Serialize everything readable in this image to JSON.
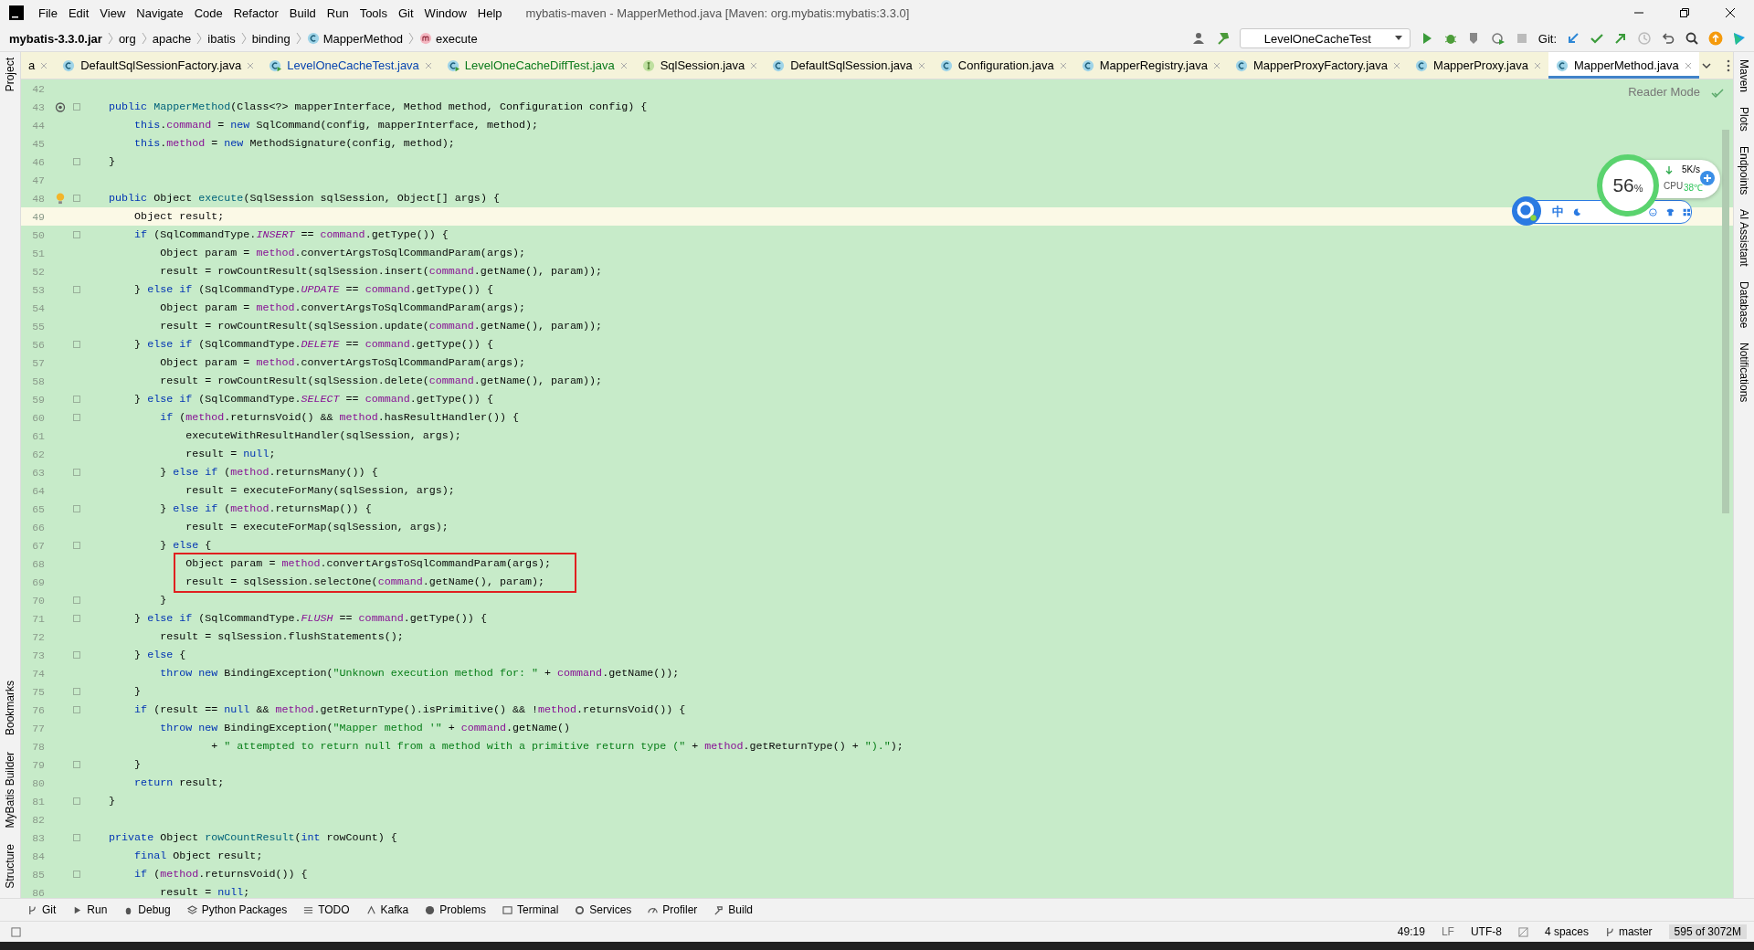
{
  "window": {
    "title": "mybatis-maven - MapperMethod.java [Maven: org.mybatis:mybatis:3.3.0]"
  },
  "menu": [
    "File",
    "Edit",
    "View",
    "Navigate",
    "Code",
    "Refactor",
    "Build",
    "Run",
    "Tools",
    "Git",
    "Window",
    "Help"
  ],
  "breadcrumbs": [
    {
      "label": "mybatis-3.3.0.jar",
      "kind": "jar"
    },
    {
      "label": "org",
      "kind": "package"
    },
    {
      "label": "apache",
      "kind": "package"
    },
    {
      "label": "ibatis",
      "kind": "package"
    },
    {
      "label": "binding",
      "kind": "package"
    },
    {
      "label": "MapperMethod",
      "kind": "class"
    },
    {
      "label": "execute",
      "kind": "method"
    }
  ],
  "toolbar": {
    "run_config": "LevelOneCacheTest",
    "git_label": "Git:"
  },
  "tabs": [
    {
      "label": "a",
      "kind": "none",
      "color": "#000000",
      "selected": false
    },
    {
      "label": "DefaultSqlSessionFactory.java",
      "kind": "class",
      "color": "#000000",
      "selected": false
    },
    {
      "label": "LevelOneCacheTest.java",
      "kind": "test",
      "color": "#0a46b0",
      "selected": false
    },
    {
      "label": "LevelOneCacheDiffTest.java",
      "kind": "test",
      "color": "#0a7a1b",
      "selected": false
    },
    {
      "label": "SqlSession.java",
      "kind": "interface",
      "color": "#000000",
      "selected": false
    },
    {
      "label": "DefaultSqlSession.java",
      "kind": "class",
      "color": "#000000",
      "selected": false
    },
    {
      "label": "Configuration.java",
      "kind": "class",
      "color": "#000000",
      "selected": false
    },
    {
      "label": "MapperRegistry.java",
      "kind": "class",
      "color": "#000000",
      "selected": false
    },
    {
      "label": "MapperProxyFactory.java",
      "kind": "class",
      "color": "#000000",
      "selected": false
    },
    {
      "label": "MapperProxy.java",
      "kind": "class",
      "color": "#000000",
      "selected": false
    },
    {
      "label": "MapperMethod.java",
      "kind": "class",
      "color": "#000000",
      "selected": true
    }
  ],
  "left_tools_top": [
    "Project"
  ],
  "left_tools_bottom": [
    "Bookmarks",
    "MyBatis Builder",
    "Structure"
  ],
  "right_tools": [
    "Maven",
    "Plots",
    "Endpoints",
    "AI Assistant",
    "Database",
    "Notifications"
  ],
  "editor": {
    "reader_mode": "Reader Mode",
    "lines": [
      {
        "num": "42",
        "fold": false
      },
      {
        "num": "43",
        "kind": "override",
        "fold": true,
        "tokens": [
          {
            "text": "    public ",
            "kind": "keyword"
          },
          {
            "text": "MapperMethod",
            "kind": "declaration"
          },
          {
            "text": "(Class<?> mapperInterface, Method method, Configuration config) {"
          }
        ]
      },
      {
        "num": "44",
        "fold": false,
        "tokens": [
          {
            "text": "        this",
            "kind": "keyword"
          },
          {
            "text": "."
          },
          {
            "text": "command",
            "kind": "field"
          },
          {
            "text": " = "
          },
          {
            "text": "new ",
            "kind": "keyword"
          },
          {
            "text": "SqlCommand(config, mapperInterface, method);"
          }
        ]
      },
      {
        "num": "45",
        "fold": false,
        "tokens": [
          {
            "text": "        this",
            "kind": "keyword"
          },
          {
            "text": "."
          },
          {
            "text": "method",
            "kind": "field"
          },
          {
            "text": " = "
          },
          {
            "text": "new ",
            "kind": "keyword"
          },
          {
            "text": "MethodSignature(config, method);"
          }
        ]
      },
      {
        "num": "46",
        "fold": true,
        "tokens": [
          {
            "text": "    }"
          }
        ]
      },
      {
        "num": "47",
        "fold": false
      },
      {
        "num": "48",
        "kind": "bulb",
        "fold": true,
        "tokens": [
          {
            "text": "    public ",
            "kind": "keyword"
          },
          {
            "text": "Object "
          },
          {
            "text": "execute",
            "kind": "declaration"
          },
          {
            "text": "(SqlSession sqlSession, Object[] args) {"
          }
        ]
      },
      {
        "num": "49",
        "current": true,
        "fold": false,
        "tokens": [
          {
            "text": "        Object result;"
          }
        ]
      },
      {
        "num": "50",
        "fold": true,
        "tokens": [
          {
            "text": "        if ",
            "kind": "keyword"
          },
          {
            "text": "(SqlCommandType."
          },
          {
            "text": "INSERT",
            "kind": "constant"
          },
          {
            "text": " == "
          },
          {
            "text": "command",
            "kind": "field"
          },
          {
            "text": ".getType()) {"
          }
        ]
      },
      {
        "num": "51",
        "fold": false,
        "tokens": [
          {
            "text": "            Object param = "
          },
          {
            "text": "method",
            "kind": "field"
          },
          {
            "text": ".convertArgsToSqlCommandParam(args);"
          }
        ]
      },
      {
        "num": "52",
        "fold": false,
        "tokens": [
          {
            "text": "            result = rowCountResult(sqlSession.insert("
          },
          {
            "text": "command",
            "kind": "field"
          },
          {
            "text": ".getName(), param));"
          }
        ]
      },
      {
        "num": "53",
        "fold": true,
        "tokens": [
          {
            "text": "        } "
          },
          {
            "text": "else if ",
            "kind": "keyword"
          },
          {
            "text": "(SqlCommandType."
          },
          {
            "text": "UPDATE",
            "kind": "constant"
          },
          {
            "text": " == "
          },
          {
            "text": "command",
            "kind": "field"
          },
          {
            "text": ".getType()) {"
          }
        ]
      },
      {
        "num": "54",
        "fold": false,
        "tokens": [
          {
            "text": "            Object param = "
          },
          {
            "text": "method",
            "kind": "field"
          },
          {
            "text": ".convertArgsToSqlCommandParam(args);"
          }
        ]
      },
      {
        "num": "55",
        "fold": false,
        "tokens": [
          {
            "text": "            result = rowCountResult(sqlSession.update("
          },
          {
            "text": "command",
            "kind": "field"
          },
          {
            "text": ".getName(), param));"
          }
        ]
      },
      {
        "num": "56",
        "fold": true,
        "tokens": [
          {
            "text": "        } "
          },
          {
            "text": "else if ",
            "kind": "keyword"
          },
          {
            "text": "(SqlCommandType."
          },
          {
            "text": "DELETE",
            "kind": "constant"
          },
          {
            "text": " == "
          },
          {
            "text": "command",
            "kind": "field"
          },
          {
            "text": ".getType()) {"
          }
        ]
      },
      {
        "num": "57",
        "fold": false,
        "tokens": [
          {
            "text": "            Object param = "
          },
          {
            "text": "method",
            "kind": "field"
          },
          {
            "text": ".convertArgsToSqlCommandParam(args);"
          }
        ]
      },
      {
        "num": "58",
        "fold": false,
        "tokens": [
          {
            "text": "            result = rowCountResult(sqlSession.delete("
          },
          {
            "text": "command",
            "kind": "field"
          },
          {
            "text": ".getName(), param));"
          }
        ]
      },
      {
        "num": "59",
        "fold": true,
        "tokens": [
          {
            "text": "        } "
          },
          {
            "text": "else if ",
            "kind": "keyword"
          },
          {
            "text": "(SqlCommandType."
          },
          {
            "text": "SELECT",
            "kind": "constant"
          },
          {
            "text": " == "
          },
          {
            "text": "command",
            "kind": "field"
          },
          {
            "text": ".getType()) {"
          }
        ]
      },
      {
        "num": "60",
        "fold": true,
        "tokens": [
          {
            "text": "            if ",
            "kind": "keyword"
          },
          {
            "text": "("
          },
          {
            "text": "method",
            "kind": "field"
          },
          {
            "text": ".returnsVoid() && "
          },
          {
            "text": "method",
            "kind": "field"
          },
          {
            "text": ".hasResultHandler()) {"
          }
        ]
      },
      {
        "num": "61",
        "fold": false,
        "tokens": [
          {
            "text": "                executeWithResultHandler(sqlSession, args);"
          }
        ]
      },
      {
        "num": "62",
        "fold": false,
        "tokens": [
          {
            "text": "                result = "
          },
          {
            "text": "null",
            "kind": "keyword"
          },
          {
            "text": ";"
          }
        ]
      },
      {
        "num": "63",
        "fold": true,
        "tokens": [
          {
            "text": "            } "
          },
          {
            "text": "else if ",
            "kind": "keyword"
          },
          {
            "text": "("
          },
          {
            "text": "method",
            "kind": "field"
          },
          {
            "text": ".returnsMany()) {"
          }
        ]
      },
      {
        "num": "64",
        "fold": false,
        "tokens": [
          {
            "text": "                result = executeForMany(sqlSession, args);"
          }
        ]
      },
      {
        "num": "65",
        "fold": true,
        "tokens": [
          {
            "text": "            } "
          },
          {
            "text": "else if ",
            "kind": "keyword"
          },
          {
            "text": "("
          },
          {
            "text": "method",
            "kind": "field"
          },
          {
            "text": ".returnsMap()) {"
          }
        ]
      },
      {
        "num": "66",
        "fold": false,
        "tokens": [
          {
            "text": "                result = executeForMap(sqlSession, args);"
          }
        ]
      },
      {
        "num": "67",
        "fold": true,
        "tokens": [
          {
            "text": "            } "
          },
          {
            "text": "else ",
            "kind": "keyword"
          },
          {
            "text": "{"
          }
        ]
      },
      {
        "num": "68",
        "boxed": true,
        "fold": false,
        "tokens": [
          {
            "text": "                Object param = "
          },
          {
            "text": "method",
            "kind": "field"
          },
          {
            "text": ".convertArgsToSqlCommandParam(args);"
          }
        ]
      },
      {
        "num": "69",
        "boxed": true,
        "fold": false,
        "tokens": [
          {
            "text": "                result = sqlSession.selectOne("
          },
          {
            "text": "command",
            "kind": "field"
          },
          {
            "text": ".getName(), param);"
          }
        ]
      },
      {
        "num": "70",
        "fold": true,
        "tokens": [
          {
            "text": "            }"
          }
        ]
      },
      {
        "num": "71",
        "fold": true,
        "tokens": [
          {
            "text": "        } "
          },
          {
            "text": "else if ",
            "kind": "keyword"
          },
          {
            "text": "(SqlCommandType."
          },
          {
            "text": "FLUSH",
            "kind": "constant"
          },
          {
            "text": " == "
          },
          {
            "text": "command",
            "kind": "field"
          },
          {
            "text": ".getType()) {"
          }
        ]
      },
      {
        "num": "72",
        "fold": false,
        "tokens": [
          {
            "text": "            result = sqlSession.flushStatements();"
          }
        ]
      },
      {
        "num": "73",
        "fold": true,
        "tokens": [
          {
            "text": "        } "
          },
          {
            "text": "else ",
            "kind": "keyword"
          },
          {
            "text": "{"
          }
        ]
      },
      {
        "num": "74",
        "fold": false,
        "tokens": [
          {
            "text": "            throw new ",
            "kind": "keyword"
          },
          {
            "text": "BindingException("
          },
          {
            "text": "\"Unknown execution method for: \"",
            "kind": "string"
          },
          {
            "text": " + "
          },
          {
            "text": "command",
            "kind": "field"
          },
          {
            "text": ".getName());"
          }
        ]
      },
      {
        "num": "75",
        "fold": true,
        "tokens": [
          {
            "text": "        }"
          }
        ]
      },
      {
        "num": "76",
        "fold": true,
        "tokens": [
          {
            "text": "        if ",
            "kind": "keyword"
          },
          {
            "text": "(result == "
          },
          {
            "text": "null ",
            "kind": "keyword"
          },
          {
            "text": "&& "
          },
          {
            "text": "method",
            "kind": "field"
          },
          {
            "text": ".getReturnType().isPrimitive() && !"
          },
          {
            "text": "method",
            "kind": "field"
          },
          {
            "text": ".returnsVoid()) {"
          }
        ]
      },
      {
        "num": "77",
        "fold": false,
        "tokens": [
          {
            "text": "            throw new ",
            "kind": "keyword"
          },
          {
            "text": "BindingException("
          },
          {
            "text": "\"Mapper method '\"",
            "kind": "string"
          },
          {
            "text": " + "
          },
          {
            "text": "command",
            "kind": "field"
          },
          {
            "text": ".getName()"
          }
        ]
      },
      {
        "num": "78",
        "fold": false,
        "tokens": [
          {
            "text": "                    + "
          },
          {
            "text": "\" attempted to return null from a method with a primitive return type (\"",
            "kind": "string"
          },
          {
            "text": " + "
          },
          {
            "text": "method",
            "kind": "field"
          },
          {
            "text": ".getReturnType() + "
          },
          {
            "text": "\").\"",
            "kind": "string"
          },
          {
            "text": ");"
          }
        ]
      },
      {
        "num": "79",
        "fold": true,
        "tokens": [
          {
            "text": "        }"
          }
        ]
      },
      {
        "num": "80",
        "fold": false,
        "tokens": [
          {
            "text": "        return ",
            "kind": "keyword"
          },
          {
            "text": "result;"
          }
        ]
      },
      {
        "num": "81",
        "fold": true,
        "tokens": [
          {
            "text": "    }"
          }
        ]
      },
      {
        "num": "82",
        "fold": false
      },
      {
        "num": "83",
        "fold": true,
        "tokens": [
          {
            "text": "    private ",
            "kind": "keyword"
          },
          {
            "text": "Object "
          },
          {
            "text": "rowCountResult",
            "kind": "declaration"
          },
          {
            "text": "("
          },
          {
            "text": "int ",
            "kind": "keyword"
          },
          {
            "text": "rowCount) {"
          }
        ]
      },
      {
        "num": "84",
        "fold": false,
        "tokens": [
          {
            "text": "        final ",
            "kind": "keyword"
          },
          {
            "text": "Object result;"
          }
        ]
      },
      {
        "num": "85",
        "fold": true,
        "tokens": [
          {
            "text": "        if ",
            "kind": "keyword"
          },
          {
            "text": "("
          },
          {
            "text": "method",
            "kind": "field"
          },
          {
            "text": ".returnsVoid()) {"
          }
        ]
      },
      {
        "num": "86",
        "fold": false,
        "tokens": [
          {
            "text": "            result = "
          },
          {
            "text": "null",
            "kind": "keyword"
          },
          {
            "text": ";"
          }
        ]
      }
    ]
  },
  "monitor": {
    "percent": "56",
    "unit": "%",
    "speed": "5K/s",
    "cpu_label": "CPU",
    "cpu_temp": "38℃",
    "ime": "中"
  },
  "bottom_tools": [
    "Git",
    "Run",
    "Debug",
    "Python Packages",
    "TODO",
    "Kafka",
    "Problems",
    "Terminal",
    "Services",
    "Profiler",
    "Build"
  ],
  "status_bar": {
    "position": "49:19",
    "line_sep": "LF",
    "encoding": "UTF-8",
    "indent": "4 spaces",
    "branch": "master",
    "memory": "595 of 3072M"
  }
}
